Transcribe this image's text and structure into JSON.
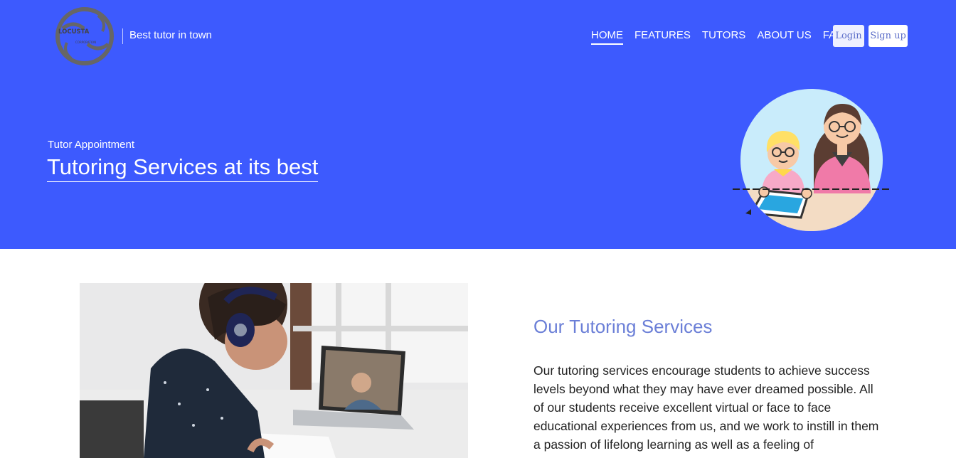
{
  "header": {
    "logo_text_top": "LOCUSTA",
    "logo_text_bottom": "CORPORATION",
    "tagline": "Best tutor in town",
    "nav": [
      "HOME",
      "FEATURES",
      "TUTORS",
      "ABOUT US",
      "FAQs"
    ],
    "active_nav": "HOME",
    "login_label": "Login",
    "signup_label": "Sign up"
  },
  "hero": {
    "eyebrow": "Tutor Appointment",
    "headline": "Tutoring Services at its best"
  },
  "services": {
    "title": "Our Tutoring Services",
    "body": "Our tutoring services encourage students to achieve success levels beyond what they may have ever dreamed possible. All of our students receive excellent virtual or face to face educational experiences from us, and we work to instill in them a passion of lifelong learning as well as a feeling of"
  },
  "colors": {
    "brand": "#3d5afe",
    "accent_title": "#6b7fd7"
  },
  "icons": [
    "logo-icon",
    "tutor-illustration",
    "student-photo"
  ]
}
